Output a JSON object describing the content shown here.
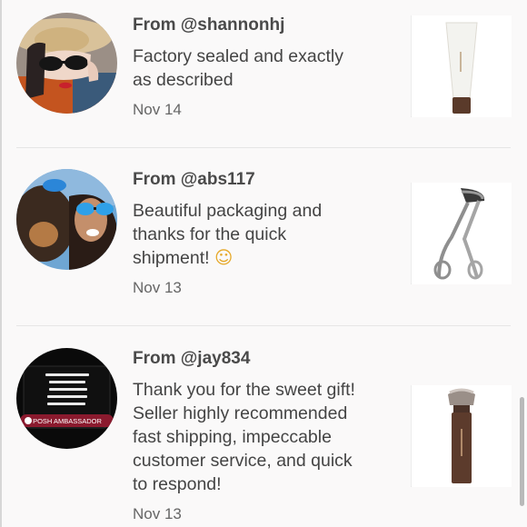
{
  "reviews": [
    {
      "from": "From @shannonhj",
      "message_lines": [
        "Factory sealed and exactly",
        "as described"
      ],
      "date": "Nov 14",
      "product_icon": "primer-tube-icon"
    },
    {
      "from": "From @abs117",
      "message_lines": [
        "Beautiful packaging and",
        "thanks for the quick",
        "shipment!"
      ],
      "emoji": "☺",
      "date": "Nov 13",
      "product_icon": "eyelash-curler-icon"
    },
    {
      "from": "From @jay834",
      "message_lines": [
        "Thank you for the sweet gift!",
        "Seller highly recommended",
        "fast shipping, impeccable",
        "customer service, and quick",
        "to respond!"
      ],
      "date": "Nov 13",
      "product_icon": "foundation-brush-icon",
      "avatar_badge": "POSH AMBASSADOR"
    }
  ]
}
